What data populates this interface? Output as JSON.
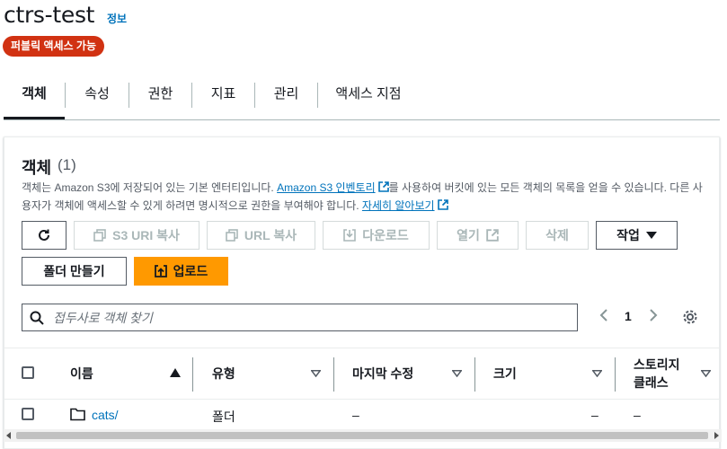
{
  "header": {
    "title": "ctrs-test",
    "info_link": "정보",
    "badge": "퍼블릭 액세스 가능"
  },
  "tabs": [
    {
      "label": "객체",
      "active": true
    },
    {
      "label": "속성",
      "active": false
    },
    {
      "label": "권한",
      "active": false
    },
    {
      "label": "지표",
      "active": false
    },
    {
      "label": "관리",
      "active": false
    },
    {
      "label": "액세스 지점",
      "active": false
    }
  ],
  "objects_panel": {
    "title": "객체",
    "count": "(1)",
    "description": {
      "part1": "객체는 Amazon S3에 저장되어 있는 기본 엔터티입니다. ",
      "link1": "Amazon S3 인벤토리",
      "part2": "를 사용하여 버킷에 있는 모든 객체의 목록을 얻을 수 있습니다. 다른 사용자가 객체에 액세스할 수 있게 하려면 명시적으로 권한을 부여해야 합니다. ",
      "link2": "자세히 알아보기"
    },
    "toolbar": {
      "refresh_icon": "refresh-icon",
      "copy_s3_uri": "S3 URI 복사",
      "copy_url": "URL 복사",
      "download": "다운로드",
      "open": "열기",
      "delete": "삭제",
      "actions": "작업",
      "create_folder": "폴더 만들기",
      "upload": "업로드"
    },
    "search": {
      "placeholder": "접두사로 객체 찾기",
      "value": ""
    },
    "pagination": {
      "current_page": "1"
    },
    "columns": [
      "이름",
      "유형",
      "마지막 수정",
      "크기",
      "스토리지 클래스"
    ],
    "storage_class_lines": [
      "스토리지",
      "클래스"
    ],
    "rows": [
      {
        "name": "cats/",
        "type": "폴더",
        "last_modified": "–",
        "size": "–",
        "storage_class": "–"
      }
    ]
  },
  "colors": {
    "accent_blue": "#0073bb",
    "primary_orange": "#ff9900",
    "badge_red": "#d13212"
  }
}
